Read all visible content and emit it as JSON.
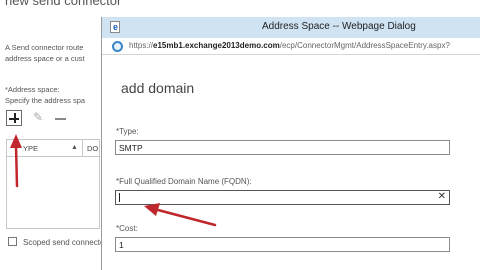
{
  "background": {
    "title": "new send connector",
    "description_lines": [
      "A Send connector route",
      "address space or a cust"
    ],
    "address_space_label": "*Address space:",
    "specify_text": "Specify the address spa",
    "toolbar": {
      "add_icon": "plus-icon",
      "edit_icon": "pencil-icon",
      "remove_icon": "minus-icon"
    },
    "grid": {
      "columns": [
        "YPE",
        "DO"
      ],
      "sort_indicator": "▲"
    },
    "scoped_label": "Scoped send connector"
  },
  "dialog": {
    "title": "Address Space -- Webpage Dialog",
    "url_prefix": "https://",
    "url_host": "e15mb1.exchange2013demo.com",
    "url_path": "/ecp/ConnectorMgmt/AddressSpaceEntry.aspx?",
    "heading": "add domain",
    "type": {
      "label": "*Type:",
      "value": "SMTP"
    },
    "fqdn": {
      "label": "*Full Qualified Domain Name (FQDN):",
      "value": "",
      "clear_glyph": "✕"
    },
    "cost": {
      "label": "*Cost:",
      "value": "1"
    }
  },
  "annotation_color": "#c0272d",
  "accent_color": "#cfe3f3"
}
